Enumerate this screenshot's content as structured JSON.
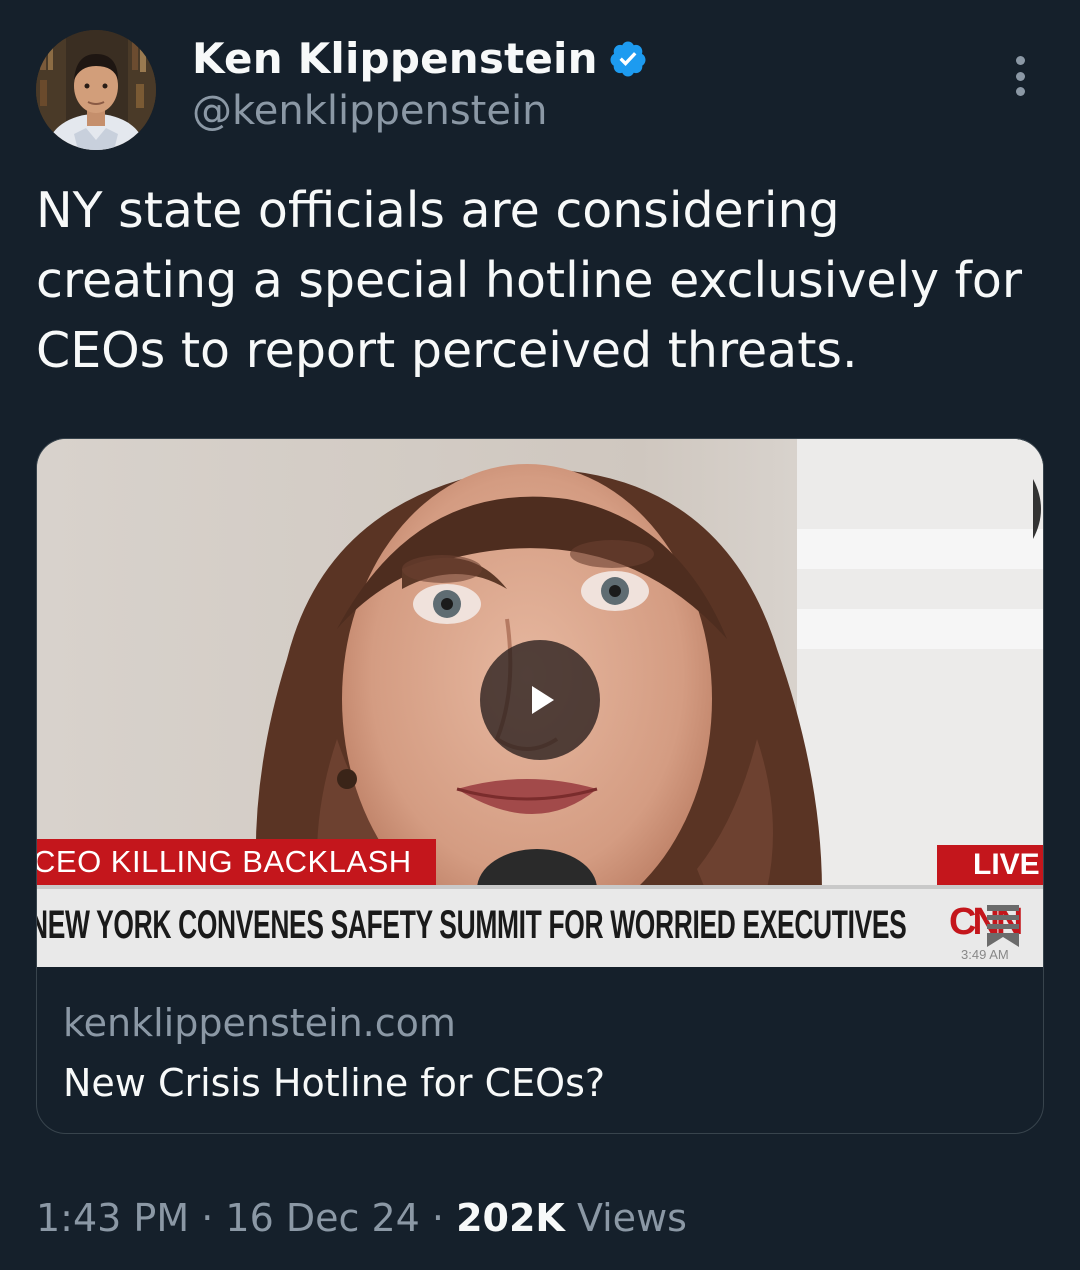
{
  "author": {
    "display_name": "Ken Klippenstein",
    "handle": "@kenklippenstein",
    "verified": true
  },
  "tweet": {
    "text": "NY state officials are considering creating a special hotline exclusively for CEOs to report perceived threats."
  },
  "card": {
    "video": {
      "banner_label": "CEO KILLING BACKLASH",
      "live_label": "LIVE",
      "headline": "NEW YORK CONVENES SAFETY SUMMIT FOR WORRIED EXECUTIVES",
      "network_logo": "CNN",
      "time": "3:49 AM"
    },
    "domain": "kenklippenstein.com",
    "title": "New Crisis Hotline for CEOs?"
  },
  "meta": {
    "time": "1:43 PM",
    "separator": "·",
    "date": "16 Dec 24",
    "views_count": "202K",
    "views_label": "Views"
  },
  "colors": {
    "background": "#15202b",
    "verified": "#1d9bf0",
    "secondary_text": "#8b98a5",
    "cnn_red": "#c4161c"
  },
  "icons": [
    "verified-badge-icon",
    "more-options-icon",
    "play-icon",
    "bookmark-icon"
  ]
}
